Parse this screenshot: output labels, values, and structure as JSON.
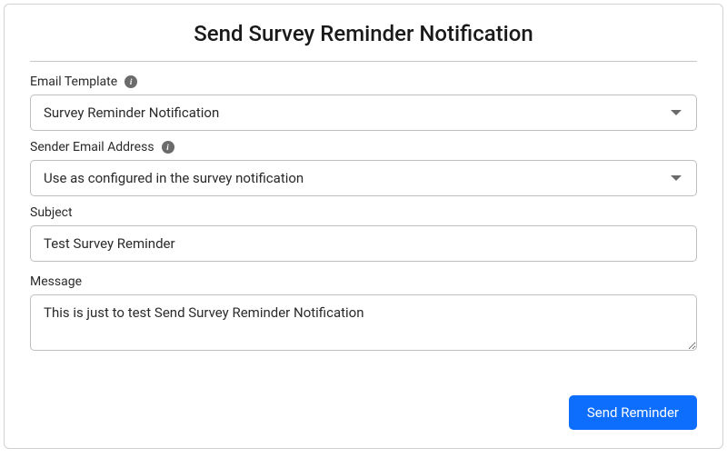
{
  "title": "Send Survey Reminder Notification",
  "fields": {
    "emailTemplate": {
      "label": "Email Template",
      "value": "Survey Reminder Notification"
    },
    "senderEmail": {
      "label": "Sender Email Address",
      "value": "Use as configured in the survey notification"
    },
    "subject": {
      "label": "Subject",
      "value": "Test Survey Reminder"
    },
    "message": {
      "label": "Message",
      "value": "This is just to test Send Survey Reminder Notification"
    }
  },
  "buttons": {
    "send": "Send Reminder"
  }
}
